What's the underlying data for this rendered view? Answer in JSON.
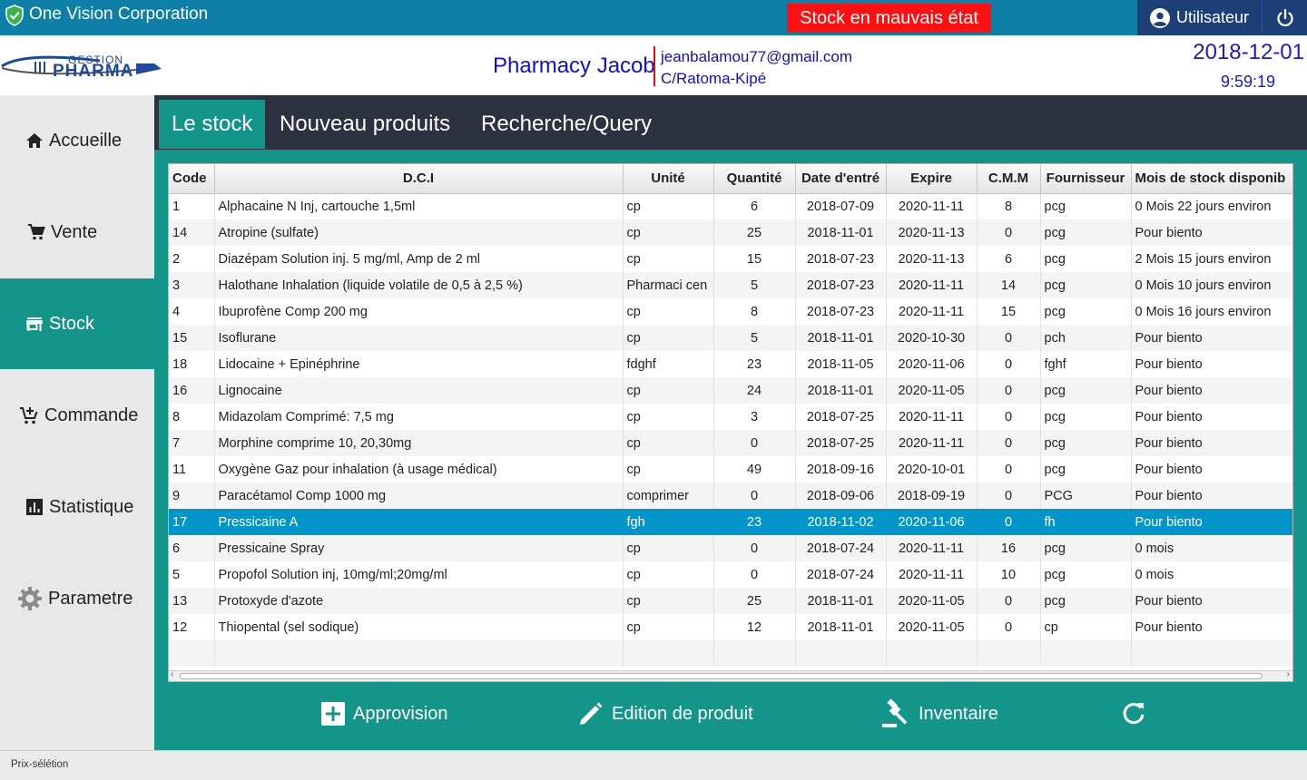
{
  "titlebar": {
    "app_title": "One Vision Corporation",
    "alert": "Stock en mauvais état",
    "user_label": "Utilisateur"
  },
  "header": {
    "brand_top": "GESTION",
    "brand_main": "PHARMA",
    "pharmacy_name": "Pharmacy Jacob",
    "email": "jeanbalamou77@gmail.com",
    "address": "C/Ratoma-Kipé",
    "date": "2018-12-01",
    "time": "9:59:19"
  },
  "sidebar": {
    "items": [
      {
        "label": "Accueille",
        "icon": "home-icon"
      },
      {
        "label": "Vente",
        "icon": "cart-icon"
      },
      {
        "label": "Stock",
        "icon": "store-icon",
        "active": true
      },
      {
        "label": "Commande",
        "icon": "cart-add-icon"
      },
      {
        "label": "Statistique",
        "icon": "chart-icon"
      },
      {
        "label": "Parametre",
        "icon": "gear-icon"
      }
    ]
  },
  "tabs": [
    {
      "label": "Le stock",
      "active": true
    },
    {
      "label": "Nouveau produits"
    },
    {
      "label": "Recherche/Query"
    }
  ],
  "table": {
    "columns": [
      "Code",
      "D.C.I",
      "Unité",
      "Quantité",
      "Date d'entré",
      "Expire",
      "C.M.M",
      "Fournisseur",
      "Mois de stock disponib"
    ],
    "rows": [
      [
        "1",
        "Alphacaine N Inj, cartouche 1,5ml",
        "cp",
        "6",
        "2018-07-09",
        "2020-11-11",
        "8",
        "pcg",
        "0 Mois 22 jours environ"
      ],
      [
        "14",
        "Atropine (sulfate)",
        "cp",
        "25",
        "2018-11-01",
        "2020-11-13",
        "0",
        "pcg",
        "Pour biento"
      ],
      [
        "2",
        "Diazépam Solution inj. 5 mg/ml, Amp de 2 ml",
        "cp",
        "15",
        "2018-07-23",
        "2020-11-13",
        "6",
        "pcg",
        "2 Mois 15 jours environ"
      ],
      [
        "3",
        "Halothane Inhalation (liquide volatile de 0,5 à 2,5 %)",
        "Pharmaci cen",
        "5",
        "2018-07-23",
        "2020-11-11",
        "14",
        "pcg",
        "0 Mois 10 jours environ"
      ],
      [
        "4",
        "Ibuprofène Comp 200 mg",
        "cp",
        "8",
        "2018-07-23",
        "2020-11-11",
        "15",
        "pcg",
        "0 Mois 16 jours environ"
      ],
      [
        "15",
        "Isoflurane",
        "cp",
        "5",
        "2018-11-01",
        "2020-10-30",
        "0",
        "pch",
        "Pour biento"
      ],
      [
        "18",
        "Lidocaine + Epinéphrine",
        "fdghf",
        "23",
        "2018-11-05",
        "2020-11-06",
        "0",
        "fghf",
        "Pour biento"
      ],
      [
        "16",
        "Lignocaine",
        "cp",
        "24",
        "2018-11-01",
        "2020-11-05",
        "0",
        "pcg",
        "Pour biento"
      ],
      [
        "8",
        "Midazolam Comprimé: 7,5 mg",
        "cp",
        "3",
        "2018-07-25",
        "2020-11-11",
        "0",
        "pcg",
        "Pour biento"
      ],
      [
        "7",
        "Morphine comprime 10, 20,30mg",
        "cp",
        "0",
        "2018-07-25",
        "2020-11-11",
        "0",
        "pcg",
        "Pour biento"
      ],
      [
        "11",
        "Oxygène Gaz pour inhalation (à usage médical)",
        "cp",
        "49",
        "2018-09-16",
        "2020-10-01",
        "0",
        "pcg",
        "Pour biento"
      ],
      [
        "9",
        "Paracétamol Comp 1000 mg",
        "comprimer",
        "0",
        "2018-09-06",
        "2018-09-19",
        "0",
        "PCG",
        "Pour biento"
      ],
      [
        "17",
        "Pressicaine A",
        "fgh",
        "23",
        "2018-11-02",
        "2020-11-06",
        "0",
        "fh",
        "Pour biento"
      ],
      [
        "6",
        "Pressicaine Spray",
        "cp",
        "0",
        "2018-07-24",
        "2020-11-11",
        "16",
        "pcg",
        "0 mois"
      ],
      [
        "5",
        "Propofol Solution inj, 10mg/ml;20mg/ml",
        "cp",
        "0",
        "2018-07-24",
        "2020-11-11",
        "10",
        "pcg",
        "0 mois"
      ],
      [
        "13",
        "Protoxyde d'azote",
        "cp",
        "25",
        "2018-11-01",
        "2020-11-05",
        "0",
        "pcg",
        "Pour biento"
      ],
      [
        "12",
        "Thiopental (sel sodique)",
        "cp",
        "12",
        "2018-11-01",
        "2020-11-05",
        "0",
        "cp",
        "Pour biento"
      ]
    ],
    "selected_row": 12
  },
  "actions": [
    {
      "label": "Approvision",
      "icon": "add-box-icon"
    },
    {
      "label": "Edition de produit",
      "icon": "pencil-icon"
    },
    {
      "label": "Inventaire",
      "icon": "gavel-icon"
    },
    {
      "label": "",
      "icon": "refresh-icon"
    }
  ],
  "statusbar": {
    "text": "Prix-sélétion"
  },
  "colors": {
    "titlebar": "#0e7fa6",
    "user_button": "#1d3f78",
    "alert": "#ff1010",
    "accent": "#139589",
    "tabbar": "#2c323f",
    "selected_row": "#0096c9"
  }
}
